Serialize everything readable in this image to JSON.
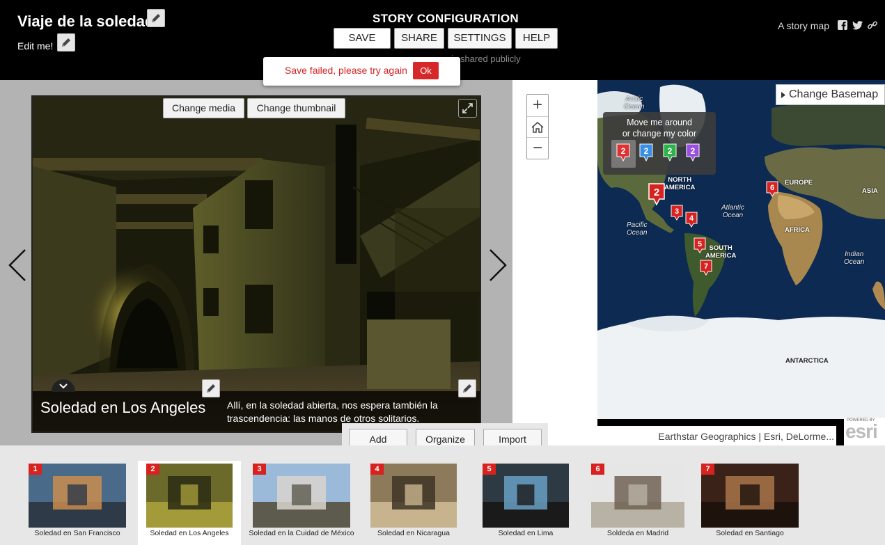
{
  "header": {
    "title": "Viaje de la soledad",
    "subtitle": "Edit me!",
    "config_title": "STORY CONFIGURATION",
    "buttons": {
      "save": "SAVE",
      "share": "SHARE",
      "settings": "SETTINGS",
      "help": "HELP"
    },
    "shared_note": "r is shared publicly",
    "brand": "A story map"
  },
  "save_popup": {
    "message": "Save failed, please try again",
    "ok": "Ok"
  },
  "media": {
    "change_media": "Change media",
    "change_thumbnail": "Change thumbnail",
    "caption_title": "Soledad en Los Angeles",
    "caption_text": "Allí, en la soledad abierta, nos espera también la trascendencia: las manos de otros solitarios."
  },
  "map": {
    "basemap_label": "Change Basemap",
    "tip_line1": "Move me around",
    "tip_line2": "or change my color",
    "tip_markers": [
      {
        "number": "2",
        "color": "#e03030"
      },
      {
        "number": "2",
        "color": "#3a8ee6"
      },
      {
        "number": "2",
        "color": "#2db34a"
      },
      {
        "number": "2",
        "color": "#9b4fe0"
      }
    ],
    "labels": {
      "arctic": "Arctic\nOcean",
      "north_america": "NORTH\nAMERICA",
      "europe": "EUROPE",
      "asia": "ASIA",
      "atlantic": "Atlantic\nOcean",
      "pacific": "Pacific\nOcean",
      "africa": "AFRICA",
      "south_america": "SOUTH\nAMERICA",
      "indian": "Indian\nOcean",
      "antarctica": "ANTARCTICA"
    },
    "markers": [
      "2",
      "3",
      "4",
      "5",
      "6",
      "7"
    ],
    "attribution": "Earthstar Geographics | Esri, DeLorme...",
    "esri_powered": "POWERED BY",
    "esri_logo": "esri"
  },
  "zoom": {
    "in": "+",
    "out": "−"
  },
  "builder": {
    "add": "Add",
    "organize": "Organize",
    "import": "Import"
  },
  "carousel": [
    {
      "number": "1",
      "label": "Soledad en San Francisco",
      "colors": [
        "#4a6a8a",
        "#c98c4e",
        "#2e3a48"
      ]
    },
    {
      "number": "2",
      "label": "Soledad en Los Angeles",
      "colors": [
        "#6b6a2a",
        "#2a2a14",
        "#a39a3a"
      ]
    },
    {
      "number": "3",
      "label": "Soledad en la Cuidad de México",
      "colors": [
        "#9bb9d9",
        "#d8d4cc",
        "#5d5a4e"
      ]
    },
    {
      "number": "4",
      "label": "Soledad en Nicaragua",
      "colors": [
        "#8d7a5a",
        "#3e3426",
        "#c7b48e"
      ]
    },
    {
      "number": "5",
      "label": "Soledad en Lima",
      "colors": [
        "#2d3a44",
        "#6aa0c4",
        "#1a1a1a"
      ]
    },
    {
      "number": "6",
      "label": "Soldeda en Madrid",
      "colors": [
        "#e6e6e6",
        "#6e6252",
        "#b8b2a4"
      ]
    },
    {
      "number": "7",
      "label": "Soledad en Santiago",
      "colors": [
        "#3a2218",
        "#a8744a",
        "#1e120c"
      ]
    }
  ]
}
